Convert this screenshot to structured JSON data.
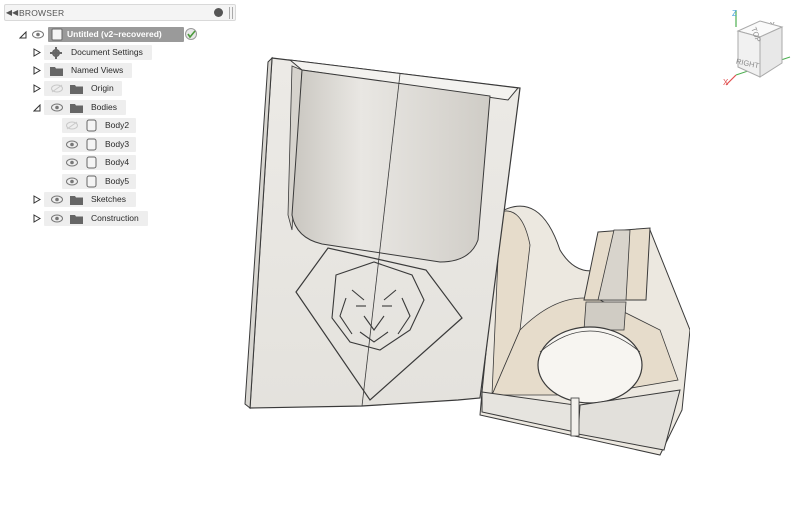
{
  "browser": {
    "title": "BROWSER",
    "collapse_icon": "double-chevron-left-icon",
    "items": [
      {
        "label": "Untitled (v2~recovered)",
        "icon": "document-icon",
        "selected": true
      },
      {
        "label": "Document Settings",
        "icon": "gear-icon"
      },
      {
        "label": "Named Views",
        "icon": "folder-icon"
      },
      {
        "label": "Origin",
        "icon": "folder-icon",
        "hidden": true
      },
      {
        "label": "Bodies",
        "icon": "folder-icon",
        "expanded": true
      },
      {
        "label": "Body2",
        "icon": "body-icon",
        "hidden": true
      },
      {
        "label": "Body3",
        "icon": "body-icon"
      },
      {
        "label": "Body4",
        "icon": "body-icon"
      },
      {
        "label": "Body5",
        "icon": "body-icon"
      },
      {
        "label": "Sketches",
        "icon": "folder-icon"
      },
      {
        "label": "Construction",
        "icon": "folder-icon"
      }
    ]
  },
  "viewcube": {
    "face_front": "RIGHT",
    "face_top": "TOP",
    "axis_z": "Z",
    "axis_x": "X",
    "axis_y": "Y"
  },
  "colors": {
    "model_face": "#eeece7",
    "model_edge": "#3a3a3a",
    "tan": "#e6dccb",
    "selected_row": "#9a9a9a"
  }
}
